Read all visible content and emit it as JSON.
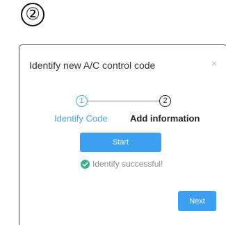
{
  "step_marker": "②",
  "dialog": {
    "title": "Identify new A/C control code",
    "close_label": "×"
  },
  "steps": [
    {
      "number": "1",
      "label": "Identify Code",
      "state": "completed"
    },
    {
      "number": "2",
      "label": "Add information",
      "state": "active"
    }
  ],
  "start_button": "Start",
  "status": {
    "text": "Identify successful!",
    "icon": "check-circle-icon"
  },
  "next_button": "Next",
  "colors": {
    "accent": "#3d9ff0",
    "step_done": "#4ba3ea",
    "success": "#3bb08f"
  }
}
